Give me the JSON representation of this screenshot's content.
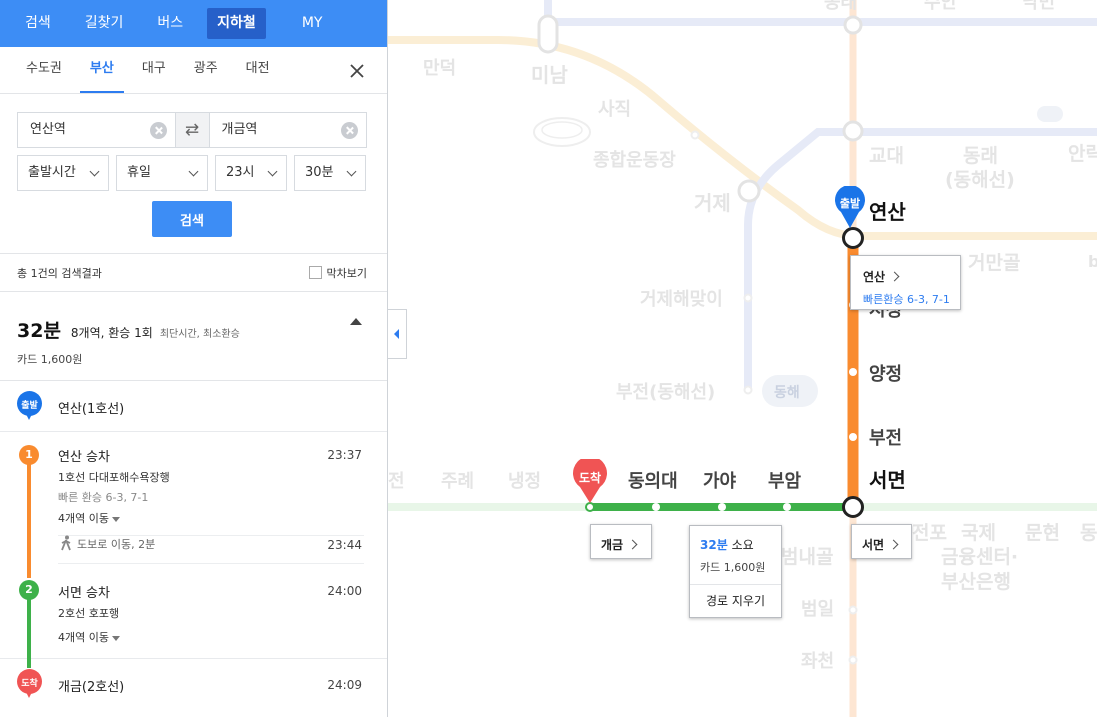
{
  "nav": {
    "tabs": [
      {
        "label": "검색"
      },
      {
        "label": "길찾기"
      },
      {
        "label": "버스"
      },
      {
        "label": "지하철",
        "active": true
      },
      {
        "label": "MY"
      }
    ],
    "accent_color": "#3d8df5"
  },
  "regions": {
    "tabs": [
      {
        "label": "수도권"
      },
      {
        "label": "부산",
        "active": true
      },
      {
        "label": "대구"
      },
      {
        "label": "광주"
      },
      {
        "label": "대전"
      }
    ],
    "close_icon": "close-icon"
  },
  "search": {
    "from": "연산역",
    "to": "개금역",
    "swap_icon": "swap-icon",
    "time_type": "출발시간",
    "day_type": "휴일",
    "hour": "23시",
    "minute": "30분",
    "button_label": "검색"
  },
  "results": {
    "count_text": "총 1건의 검색결과",
    "last_train_label": "막차보기"
  },
  "summary": {
    "time": "32분",
    "info": "8개역, 환승 1회",
    "tag": "최단시간, 최소환승",
    "fare": "카드 1,600원"
  },
  "route": {
    "depart": {
      "badge": "출발",
      "station": "연산(1호선)"
    },
    "steps": [
      {
        "num": "1",
        "title": "연산 승차",
        "time": "23:37",
        "direction": "1호선 다대포해수욕장행",
        "transfer": "빠른 환승 6-3, 7-1",
        "stops": "4개역 이동",
        "walk": "도보로 이동, 2분",
        "walk_time": "23:44",
        "color": "#f98b2f"
      },
      {
        "num": "2",
        "title": "서면 승차",
        "time": "24:00",
        "direction": "2호선 호포행",
        "stops": "4개역 이동",
        "color": "#3eb14a"
      }
    ],
    "arrive": {
      "badge": "도착",
      "station": "개금(2호선)",
      "time": "24:09"
    }
  },
  "map": {
    "line1_color": "#f98b2f",
    "line2_color": "#3eb14a",
    "stations_line1": [
      "연산",
      "시청",
      "양정",
      "부전",
      "서면"
    ],
    "stations_line2": [
      "개금",
      "동의대",
      "가야",
      "부암",
      "서면"
    ],
    "faded_labels": [
      "동래",
      "수안",
      "낙민",
      "만덕",
      "미남",
      "사직",
      "종합운동장",
      "거제",
      "교대",
      "동래",
      "(동해선)",
      "안락",
      "거제해맞이",
      "부전(동해선)",
      "동해",
      "거만골",
      "전",
      "주례",
      "냉정",
      "전포",
      "국제",
      "금융센터·",
      "부산은행",
      "문현",
      "범내골",
      "범일",
      "좌천",
      "동래",
      "b"
    ],
    "depart_pin": "출발",
    "arrive_pin": "도착",
    "callout_yeonsan": {
      "name": "연산",
      "transfer": "빠른환승 6-3, 7-1"
    },
    "callout_gaegeum": {
      "name": "개금"
    },
    "callout_seomyeon": {
      "name": "서면"
    },
    "callout_route": {
      "time": "32분",
      "time_suffix": "소요",
      "fare": "카드 1,600원",
      "clear": "경로 지우기"
    }
  }
}
